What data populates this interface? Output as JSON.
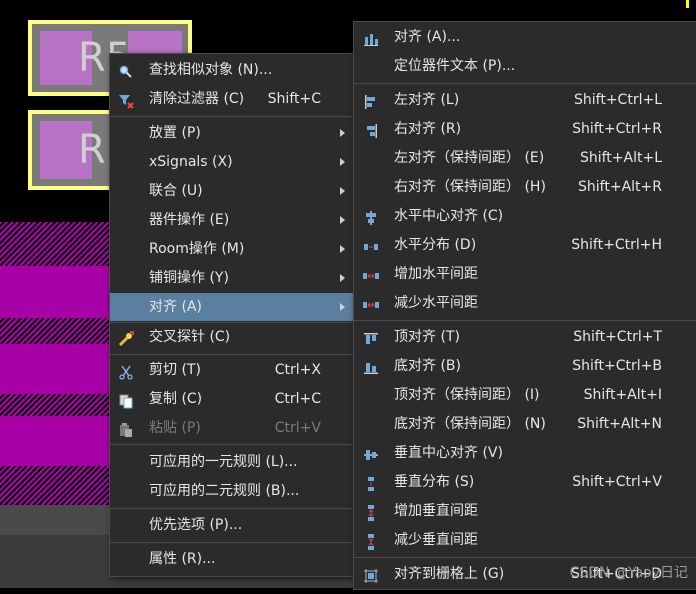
{
  "canvas": {
    "component_labels": [
      "R5",
      "R"
    ]
  },
  "main_menu": {
    "items": [
      {
        "label": "查找相似对象 (N)...",
        "shortcut": "",
        "icon": "search-icon",
        "submenu": false,
        "highlighted": false,
        "disabled": false
      },
      {
        "label": "清除过滤器 (C)",
        "shortcut": "Shift+C",
        "icon": "clear-filter-icon",
        "submenu": false,
        "highlighted": false,
        "disabled": false
      },
      {
        "label": "放置 (P)",
        "shortcut": "",
        "icon": "",
        "submenu": true,
        "highlighted": false,
        "disabled": false
      },
      {
        "label": "xSignals (X)",
        "shortcut": "",
        "icon": "",
        "submenu": true,
        "highlighted": false,
        "disabled": false
      },
      {
        "label": "联合 (U)",
        "shortcut": "",
        "icon": "",
        "submenu": true,
        "highlighted": false,
        "disabled": false
      },
      {
        "label": "器件操作 (E)",
        "shortcut": "",
        "icon": "",
        "submenu": true,
        "highlighted": false,
        "disabled": false
      },
      {
        "label": "Room操作 (M)",
        "shortcut": "",
        "icon": "",
        "submenu": true,
        "highlighted": false,
        "disabled": false
      },
      {
        "label": "铺铜操作 (Y)",
        "shortcut": "",
        "icon": "",
        "submenu": true,
        "highlighted": false,
        "disabled": false
      },
      {
        "label": "对齐 (A)",
        "shortcut": "",
        "icon": "",
        "submenu": true,
        "highlighted": true,
        "disabled": false
      },
      {
        "label": "交叉探针 (C)",
        "shortcut": "",
        "icon": "cross-probe-icon",
        "submenu": false,
        "highlighted": false,
        "disabled": false
      },
      {
        "label": "剪切 (T)",
        "shortcut": "Ctrl+X",
        "icon": "scissors-icon",
        "submenu": false,
        "highlighted": false,
        "disabled": false
      },
      {
        "label": "复制 (C)",
        "shortcut": "Ctrl+C",
        "icon": "copy-icon",
        "submenu": false,
        "highlighted": false,
        "disabled": false
      },
      {
        "label": "粘贴 (P)",
        "shortcut": "Ctrl+V",
        "icon": "paste-icon",
        "submenu": false,
        "highlighted": false,
        "disabled": true
      },
      {
        "label": "可应用的一元规则 (L)...",
        "shortcut": "",
        "icon": "",
        "submenu": false,
        "highlighted": false,
        "disabled": false
      },
      {
        "label": "可应用的二元规则 (B)...",
        "shortcut": "",
        "icon": "",
        "submenu": false,
        "highlighted": false,
        "disabled": false
      },
      {
        "label": "优先选项 (P)...",
        "shortcut": "",
        "icon": "",
        "submenu": false,
        "highlighted": false,
        "disabled": false
      },
      {
        "label": "属性 (R)...",
        "shortcut": "",
        "icon": "",
        "submenu": false,
        "highlighted": false,
        "disabled": false
      }
    ]
  },
  "align_submenu": {
    "items": [
      {
        "label": "对齐 (A)...",
        "shortcut": "",
        "icon": "align-icon"
      },
      {
        "label": "定位器件文本 (P)...",
        "shortcut": "",
        "icon": ""
      },
      {
        "label": "左对齐 (L)",
        "shortcut": "Shift+Ctrl+L",
        "icon": "align-left-icon"
      },
      {
        "label": "右对齐 (R)",
        "shortcut": "Shift+Ctrl+R",
        "icon": "align-right-icon"
      },
      {
        "label": "左对齐（保持间距） (E)",
        "shortcut": "Shift+Alt+L",
        "icon": ""
      },
      {
        "label": "右对齐（保持间距） (H)",
        "shortcut": "Shift+Alt+R",
        "icon": ""
      },
      {
        "label": "水平中心对齐 (C)",
        "shortcut": "",
        "icon": "align-horizontal-center-icon"
      },
      {
        "label": "水平分布 (D)",
        "shortcut": "Shift+Ctrl+H",
        "icon": "distribute-horizontal-icon"
      },
      {
        "label": "增加水平间距",
        "shortcut": "",
        "icon": "increase-horizontal-spacing-icon"
      },
      {
        "label": "减少水平间距",
        "shortcut": "",
        "icon": "decrease-horizontal-spacing-icon"
      },
      {
        "label": "顶对齐 (T)",
        "shortcut": "Shift+Ctrl+T",
        "icon": "align-top-icon"
      },
      {
        "label": "底对齐 (B)",
        "shortcut": "Shift+Ctrl+B",
        "icon": "align-bottom-icon"
      },
      {
        "label": "顶对齐（保持间距） (I)",
        "shortcut": "Shift+Alt+I",
        "icon": ""
      },
      {
        "label": "底对齐（保持间距） (N)",
        "shortcut": "Shift+Alt+N",
        "icon": ""
      },
      {
        "label": "垂直中心对齐 (V)",
        "shortcut": "",
        "icon": "align-vertical-center-icon"
      },
      {
        "label": "垂直分布 (S)",
        "shortcut": "Shift+Ctrl+V",
        "icon": "distribute-vertical-icon"
      },
      {
        "label": "增加垂直间距",
        "shortcut": "",
        "icon": "increase-vertical-spacing-icon"
      },
      {
        "label": "减少垂直间距",
        "shortcut": "",
        "icon": "decrease-vertical-spacing-icon"
      },
      {
        "label": "对齐到栅格上 (G)",
        "shortcut": "Shift+Ctrl+D",
        "icon": "align-to-grid-icon"
      }
    ]
  },
  "watermark": "CSDN @Yaoy日记",
  "colors": {
    "menu_bg": "#2b2b2b",
    "highlight": "#5a7fa0",
    "silkscreen": "#ffff80",
    "pad": "#b872c6",
    "copper_pour": "#a600a6",
    "icon_blue": "#6fa8dc"
  }
}
